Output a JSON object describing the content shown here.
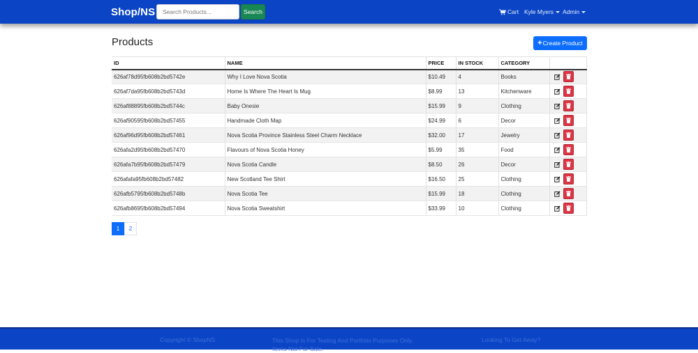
{
  "header": {
    "brand": "Shop/NS",
    "search_placeholder": "Search Products...",
    "search_button": "Search",
    "cart": "Cart",
    "user": "Kyle Myers",
    "admin": "Admin"
  },
  "main": {
    "title": "Products",
    "create_button": "Create Product",
    "columns": {
      "id": "ID",
      "name": "NAME",
      "price": "PRICE",
      "stock": "IN STOCK",
      "category": "CATEGORY"
    },
    "rows": [
      {
        "id": "626af78d95fb608b2bd5742e",
        "name": "Why I Love Nova Scotia",
        "price": "$10.49",
        "stock": "4",
        "category": "Books"
      },
      {
        "id": "626af7da95fb608b2bd5743d",
        "name": "Home Is Where The Heart Is Mug",
        "price": "$8.99",
        "stock": "13",
        "category": "Kitchenware"
      },
      {
        "id": "626af88895fb608b2bd5744c",
        "name": "Baby Onesie",
        "price": "$15.99",
        "stock": "9",
        "category": "Clothing"
      },
      {
        "id": "626af90595fb608b2bd57455",
        "name": "Handmade Cloth Map",
        "price": "$24.99",
        "stock": "6",
        "category": "Decor"
      },
      {
        "id": "626af96d95fb608b2bd57461",
        "name": "Nova Scotia Province Stainless Steel Charm Necklace",
        "price": "$32.00",
        "stock": "17",
        "category": "Jewelry"
      },
      {
        "id": "626afa2d95fb608b2bd57470",
        "name": "Flavours of Nova Scotia Honey",
        "price": "$5.99",
        "stock": "35",
        "category": "Food"
      },
      {
        "id": "626afa7b95fb608b2bd57479",
        "name": "Nova Scotia Candle",
        "price": "$8.50",
        "stock": "26",
        "category": "Decor"
      },
      {
        "id": "626afafa95fb608b2bd57482",
        "name": "New Scotland Tee Shirt",
        "price": "$16.50",
        "stock": "25",
        "category": "Clothing"
      },
      {
        "id": "626afb5795fb608b2bd5748b",
        "name": "Nova Scotia Tee",
        "price": "$15.99",
        "stock": "18",
        "category": "Clothing"
      },
      {
        "id": "626afb8695fb608b2bd57494",
        "name": "Nova Scotia Sweatshirt",
        "price": "$33.99",
        "stock": "10",
        "category": "Clothing"
      }
    ],
    "pagination": {
      "pages": [
        "1",
        "2"
      ],
      "active": "1"
    }
  },
  "footer": {
    "copyright": "Copyright © ShopNS",
    "disclaimer": "This Shop Is For Testing And Portfolio Purposes Only. Items Not For Sale.",
    "getaway": "Looking To Get Away?"
  },
  "colors": {
    "nav_bg": "#0b45c6",
    "primary": "#0d6efd",
    "success": "#198754",
    "danger": "#dc3545"
  },
  "icons": {
    "cart": "cart-icon",
    "edit": "edit-icon",
    "delete": "trash-icon",
    "dropdown": "caret-down-icon"
  }
}
